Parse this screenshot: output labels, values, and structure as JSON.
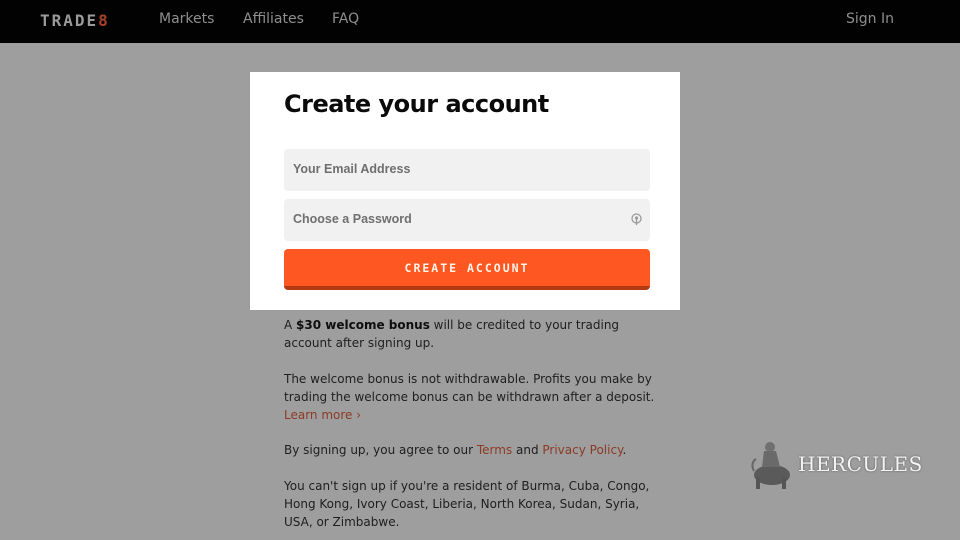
{
  "header": {
    "logo_text": "TRADE",
    "logo_accent": "8",
    "nav": [
      {
        "label": "Markets"
      },
      {
        "label": "Affiliates"
      },
      {
        "label": "FAQ"
      }
    ],
    "sign_in_label": "Sign In"
  },
  "form": {
    "title": "Create your account",
    "email_placeholder": "Your Email Address",
    "password_placeholder": "Choose a Password",
    "password_icon": "password-manager-icon",
    "submit_label": "CREATE ACCOUNT"
  },
  "info": {
    "bonus_prefix": "A ",
    "bonus_bold": "$30 welcome bonus",
    "bonus_suffix": " will be credited to your trading account after signing up.",
    "withdraw_text": "The welcome bonus is not withdrawable. Profits you make by trading the welcome bonus can be withdrawn after a deposit. ",
    "learn_more_label": "Learn more ›",
    "terms_prefix": "By signing up, you agree to our ",
    "terms_label": "Terms",
    "terms_and": " and ",
    "privacy_label": "Privacy Policy",
    "terms_suffix": ".",
    "restriction_text": "You can't sign up if you're a resident of Burma, Cuba, Congo, Hong Kong, Ivory Coast, Liberia, North Korea, Sudan, Syria, USA, or Zimbabwe."
  },
  "watermark": {
    "text": "HERCULES"
  },
  "colors": {
    "accent": "#fe5722",
    "link": "#8c3a26",
    "overlay": "#9e9e9e",
    "topbar": "#020202"
  }
}
